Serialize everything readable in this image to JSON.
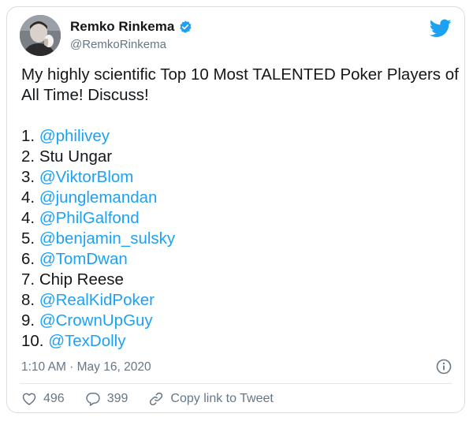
{
  "author": {
    "display_name": "Remko Rinkema",
    "handle": "@RemkoRinkema",
    "verified": true
  },
  "tweet": {
    "intro_line1": "My highly scientific Top 10 Most TALENTED Poker Players of",
    "intro_line2": "All Time! Discuss!",
    "ranking": [
      {
        "rank": "1.",
        "name": "@philivey",
        "mention": true
      },
      {
        "rank": "2.",
        "name": "Stu Ungar",
        "mention": false
      },
      {
        "rank": "3.",
        "name": "@ViktorBlom",
        "mention": true
      },
      {
        "rank": "4.",
        "name": "@junglemandan",
        "mention": true
      },
      {
        "rank": "4.",
        "name": "@PhilGalfond",
        "mention": true
      },
      {
        "rank": "5.",
        "name": "@benjamin_sulsky",
        "mention": true
      },
      {
        "rank": "6.",
        "name": "@TomDwan",
        "mention": true
      },
      {
        "rank": "7.",
        "name": "Chip Reese",
        "mention": false
      },
      {
        "rank": "8.",
        "name": "@RealKidPoker",
        "mention": true
      },
      {
        "rank": "9.",
        "name": "@CrownUpGuy",
        "mention": true
      },
      {
        "rank": "10.",
        "name": "@TexDolly",
        "mention": true
      }
    ]
  },
  "timestamp": "1:10 AM · May 16, 2020",
  "actions": {
    "likes": "496",
    "replies": "399",
    "copy_link": "Copy link to Tweet"
  },
  "icons": {
    "logo": "twitter-bird-icon",
    "verified": "verified-badge-icon",
    "info": "info-icon",
    "like": "heart-icon",
    "reply": "reply-bubble-icon",
    "copy": "link-icon"
  },
  "colors": {
    "accent": "#1da1f2",
    "text": "#14171a",
    "muted": "#657786"
  }
}
